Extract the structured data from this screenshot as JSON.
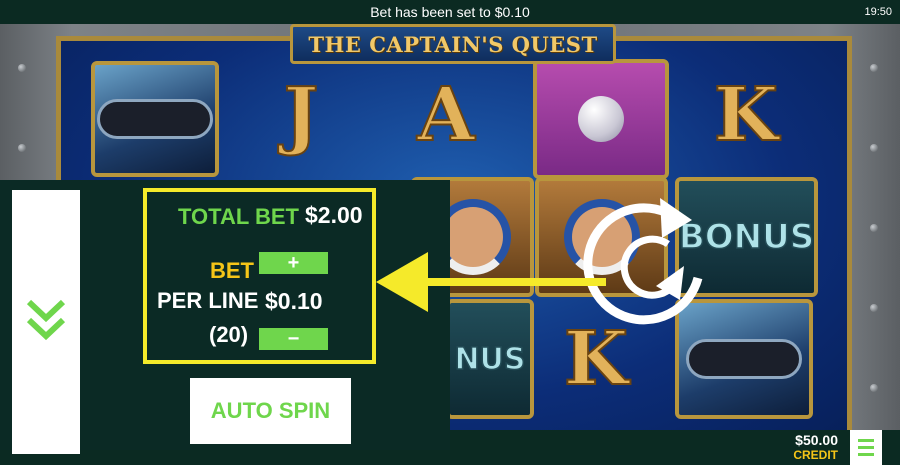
{
  "status_bar": {
    "message": "Bet has been set to $0.10",
    "clock": "19:50"
  },
  "game": {
    "title": "THE CAPTAIN'S QUEST",
    "symbols": {
      "letter_j": "J",
      "letter_a": "A",
      "letter_k": "K",
      "bonus": "BONUS",
      "bonus_partial": "NUS"
    }
  },
  "bet_panel": {
    "total_bet_label": "TOTAL BET",
    "total_bet_value": "$2.00",
    "bet_label": "BET",
    "per_line_label": "PER LINE",
    "per_line_value": "$0.10",
    "lines_label": "(20)",
    "increase_label": "+",
    "decrease_label": "−",
    "auto_spin_label": "AUTO SPIN"
  },
  "footer": {
    "credit_value": "$50.00",
    "credit_label": "CREDIT"
  },
  "colors": {
    "panel_bg": "#0b2a25",
    "accent_green": "#6fd64c",
    "highlight_yellow": "#f5ea2a",
    "bet_gold": "#f5c518"
  },
  "icons": {
    "collapse": "chevron-double-down-icon",
    "spin": "reload-icon",
    "pointer": "arrow-left-icon",
    "menu": "hamburger-menu-icon"
  }
}
